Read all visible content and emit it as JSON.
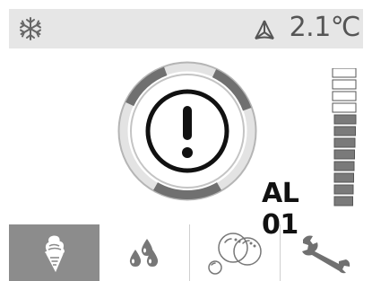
{
  "status_bar": {
    "left_icon": "snowflake-icon",
    "fan_icon": "fan-icon",
    "temperature": "2.1℃"
  },
  "alarm": {
    "icon": "alarm-exclamation-icon",
    "code": "AL 01"
  },
  "level_indicator": {
    "icon": "level-bars-icon",
    "total_segments": 12,
    "filled_segments": 8
  },
  "tabs": [
    {
      "icon": "ice-cream-cone-icon",
      "active": true
    },
    {
      "icon": "water-drops-icon",
      "active": false
    },
    {
      "icon": "bubbles-icon",
      "active": false
    },
    {
      "icon": "wrench-icon",
      "active": false
    }
  ],
  "colors": {
    "status_bar_bg": "#e6e6e6",
    "ring_segment": "#707070",
    "ring_outline": "#b0b0b0",
    "active_tab_bg": "#8c8c8c",
    "level_filled": "#7a7a7a"
  }
}
